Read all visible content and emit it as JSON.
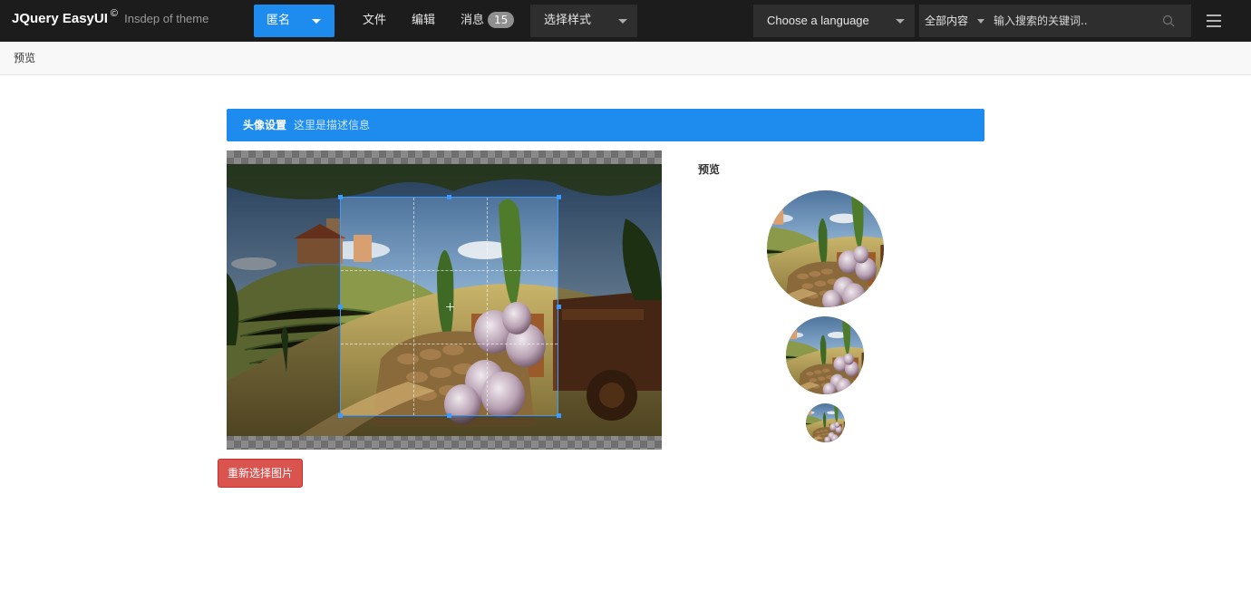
{
  "app": {
    "brand_name": "JQuery EasyUI",
    "brand_mark": "©",
    "brand_sub": "Insdep of theme"
  },
  "nav": {
    "user_label": "匿名",
    "files": "文件",
    "edit": "编辑",
    "messages": "消息",
    "message_count": "15",
    "style_select": "选择样式",
    "language_select": "Choose a language",
    "search_category": "全部内容",
    "search_placeholder": "输入搜索的关键词.."
  },
  "breadcrumb": {
    "title": "预览"
  },
  "panel": {
    "title": "头像设置",
    "description": "这里是描述信息"
  },
  "cropper": {
    "reselect_label": "重新选择图片"
  },
  "preview": {
    "label": "预览"
  },
  "colors": {
    "navbar": "#1c1c1c",
    "accent": "#1e8cef",
    "danger": "#d9534f",
    "crop_border": "#3b9bff"
  },
  "icons": [
    "caret-down-icon",
    "search-icon",
    "menu-icon",
    "crop-center-icon"
  ]
}
